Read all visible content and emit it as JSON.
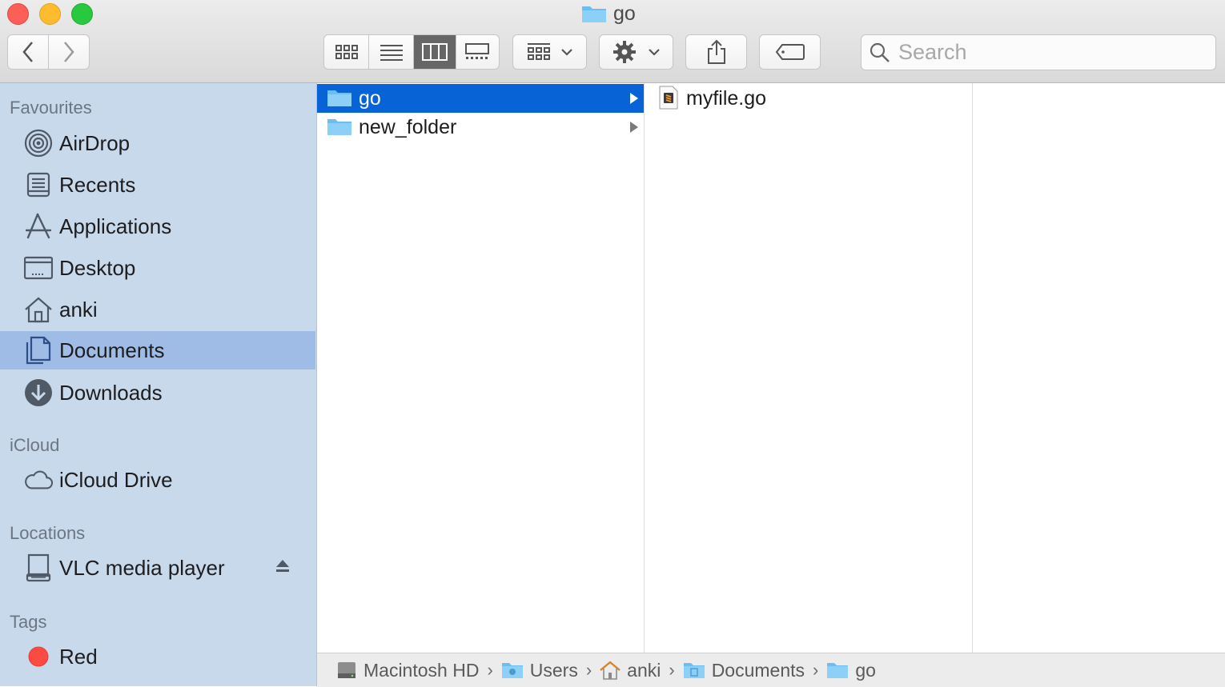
{
  "window": {
    "title": "go",
    "title_icon": "folder-icon"
  },
  "toolbar": {
    "back_icon": "chevron-left-icon",
    "forward_icon": "chevron-right-icon",
    "view_modes": [
      "icon-view",
      "list-view",
      "column-view",
      "gallery-view"
    ],
    "active_view": "column-view",
    "group_icon": "grid-icon",
    "action_icon": "gear-icon",
    "share_icon": "share-icon",
    "tag_icon": "tag-icon"
  },
  "search": {
    "placeholder": "Search",
    "value": ""
  },
  "sidebar": {
    "favourites_heading": "Favourites",
    "favourites": [
      {
        "label": "AirDrop",
        "icon": "airdrop-icon"
      },
      {
        "label": "Recents",
        "icon": "recents-icon"
      },
      {
        "label": "Applications",
        "icon": "applications-icon"
      },
      {
        "label": "Desktop",
        "icon": "desktop-icon"
      },
      {
        "label": "anki",
        "icon": "home-icon"
      },
      {
        "label": "Documents",
        "icon": "documents-icon",
        "selected": true
      },
      {
        "label": "Downloads",
        "icon": "downloads-icon"
      }
    ],
    "icloud_heading": "iCloud",
    "icloud": [
      {
        "label": "iCloud Drive",
        "icon": "cloud-icon"
      }
    ],
    "locations_heading": "Locations",
    "locations": [
      {
        "label": "VLC media player",
        "icon": "drive-icon",
        "eject_icon": "eject-icon"
      }
    ],
    "tags_heading": "Tags",
    "tags": [
      {
        "label": "Red",
        "color": "#fc4b43"
      }
    ]
  },
  "columns": {
    "col1": [
      {
        "label": "go",
        "icon": "folder-icon",
        "selected": true,
        "has_children": true
      },
      {
        "label": "new_folder",
        "icon": "folder-icon",
        "selected": false,
        "has_children": true
      }
    ],
    "col2": [
      {
        "label": "myfile.go",
        "icon": "sublime-file-icon"
      }
    ]
  },
  "pathbar": [
    {
      "label": "Macintosh HD",
      "icon": "hard-drive-icon"
    },
    {
      "label": "Users",
      "icon": "users-folder-icon"
    },
    {
      "label": "anki",
      "icon": "home-icon"
    },
    {
      "label": "Documents",
      "icon": "documents-folder-icon"
    },
    {
      "label": "go",
      "icon": "folder-icon"
    }
  ],
  "colors": {
    "selection": "#0864d6",
    "sidebar": "#c9d9ec",
    "sidebar_selected": "#9fbce6",
    "folder": "#6bbdf2"
  }
}
